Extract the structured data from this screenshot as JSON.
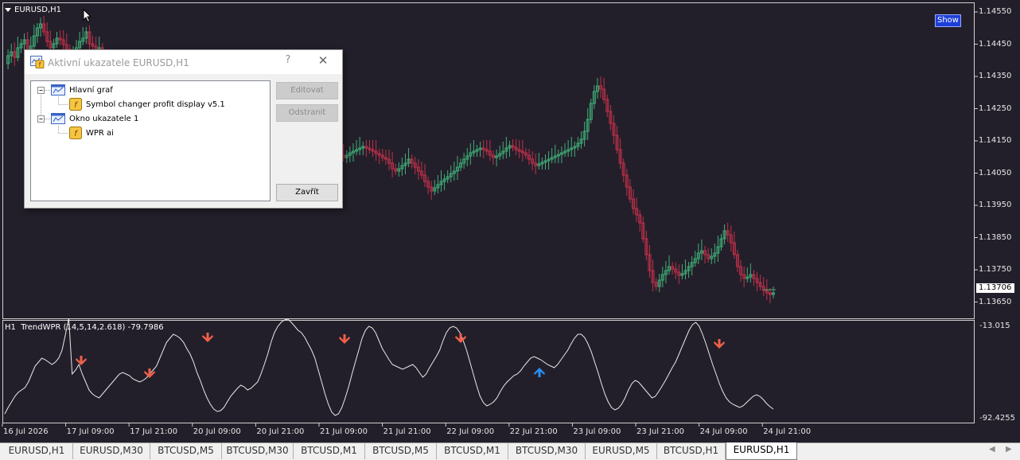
{
  "chart": {
    "symbol_label": "EURUSD,H1",
    "show_button": "Show",
    "price_labels": [
      "1.14550",
      "1.14450",
      "1.14350",
      "1.14250",
      "1.14150",
      "1.14050",
      "1.13950",
      "1.13850",
      "1.13750",
      "1.13650"
    ],
    "current_price": "1.13706",
    "time_labels": [
      "16 Jul 2026",
      "17 Jul 09:00",
      "17 Jul 21:00",
      "20 Jul 09:00",
      "20 Jul 21:00",
      "21 Jul 09:00",
      "21 Jul 21:00",
      "22 Jul 09:00",
      "22 Jul 21:00",
      "23 Jul 09:00",
      "23 Jul 21:00",
      "24 Jul 09:00",
      "24 Jul 21:00"
    ],
    "colors": {
      "background": "#231f2a",
      "bull": "#3fae78",
      "bear": "#c0304a",
      "wpr_line": "#e8e8e8",
      "sell_arrow": "#f0604a",
      "buy_arrow": "#2a8ff0"
    }
  },
  "indicator": {
    "title": "H1  TrendWPR (14,5,14,2.618) -79.7986",
    "scale_top": "-13.015",
    "scale_bottom": "-92.4255"
  },
  "dialog": {
    "title": "Aktivní ukazatele EURUSD,H1",
    "help_label": "?",
    "close_label": "✕",
    "tree": [
      {
        "label": "Hlavní graf",
        "kind": "window"
      },
      {
        "label": "Symbol changer profit display v5.1",
        "kind": "indicator"
      },
      {
        "label": "Okno ukazatele 1",
        "kind": "window"
      },
      {
        "label": "WPR ai",
        "kind": "indicator"
      }
    ],
    "buttons": {
      "edit": "Editovat",
      "remove": "Odstranit",
      "close": "Zavřít"
    }
  },
  "tabs": [
    "EURUSD,H1",
    "EURUSD,M30",
    "BTCUSD,M5",
    "BTCUSD,M30",
    "BTCUSD,M1",
    "BTCUSD,M5",
    "BTCUSD,M1",
    "BTCUSD,M30",
    "EURUSD,M5",
    "BTCUSD,H1",
    "EURUSD,H1"
  ],
  "active_tab_index": 10,
  "scroll": {
    "left": "◀",
    "right": "▶"
  }
}
